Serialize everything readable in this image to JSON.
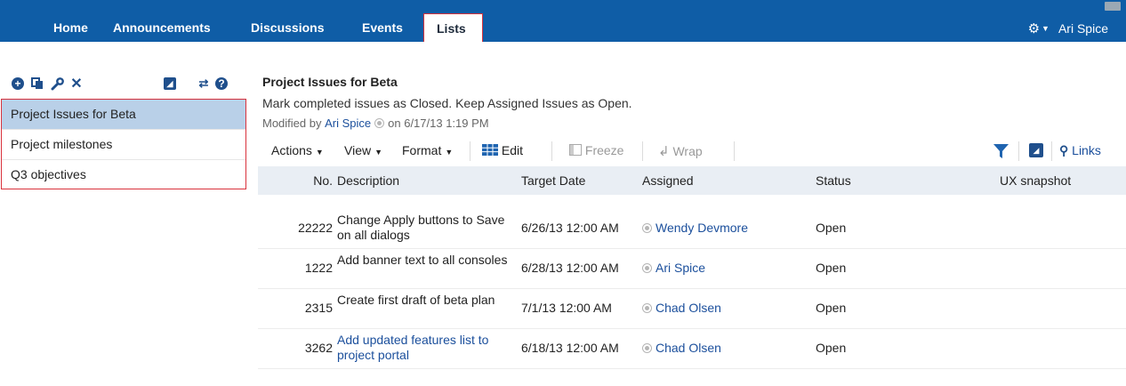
{
  "nav": {
    "items": [
      {
        "label": "Home"
      },
      {
        "label": "Announcements"
      },
      {
        "label": "Discussions"
      },
      {
        "label": "Events"
      },
      {
        "label": "Lists"
      }
    ],
    "active": "Lists",
    "user": "Ari Spice"
  },
  "left": {
    "lists": [
      {
        "name": "Project Issues for Beta",
        "selected": true
      },
      {
        "name": "Project milestones"
      },
      {
        "name": "Q3 objectives"
      }
    ]
  },
  "main": {
    "title": "Project Issues for Beta",
    "description": "Mark completed issues as Closed. Keep Assigned Issues as Open.",
    "modified_prefix": "Modified by",
    "modified_by": "Ari Spice",
    "modified_suffix": "on 6/17/13 1:19 PM",
    "toolbar": {
      "actions": "Actions",
      "view": "View",
      "format": "Format",
      "edit": "Edit",
      "freeze": "Freeze",
      "wrap": "Wrap",
      "links": "Links"
    },
    "columns": [
      "No.",
      "Description",
      "Target Date",
      "Assigned",
      "Status",
      "UX snapshot"
    ],
    "rows": [
      {
        "no": "22222",
        "description": "Change Apply buttons to Save on all dialogs",
        "target_date": "6/26/13 12:00 AM",
        "assigned": "Wendy Devmore",
        "status": "Open",
        "description_is_link": false
      },
      {
        "no": "1222",
        "description": "Add banner text to all consoles",
        "target_date": "6/28/13 12:00 AM",
        "assigned": "Ari Spice",
        "status": "Open",
        "description_is_link": false
      },
      {
        "no": "2315",
        "description": "Create first draft of beta plan",
        "target_date": "7/1/13 12:00 AM",
        "assigned": "Chad Olsen",
        "status": "Open",
        "description_is_link": false
      },
      {
        "no": "3262",
        "description": "Add updated features list to project portal",
        "target_date": "6/18/13 12:00 AM",
        "assigned": "Chad Olsen",
        "status": "Open",
        "description_is_link": true
      }
    ]
  },
  "colors": {
    "nav_bg": "#0f5da6",
    "selected_list_bg": "#b9d0e8",
    "highlight_border": "#d9323c",
    "link": "#1b4f9c",
    "header_bg": "#e9eef4"
  },
  "icons": [
    "add-icon",
    "copy-icon",
    "wrench-icon",
    "delete-icon",
    "rss-icon",
    "refresh-icon",
    "help-icon",
    "gear-icon",
    "filter-icon",
    "link-icon",
    "table-edit-icon",
    "freeze-icon",
    "wrap-icon"
  ]
}
